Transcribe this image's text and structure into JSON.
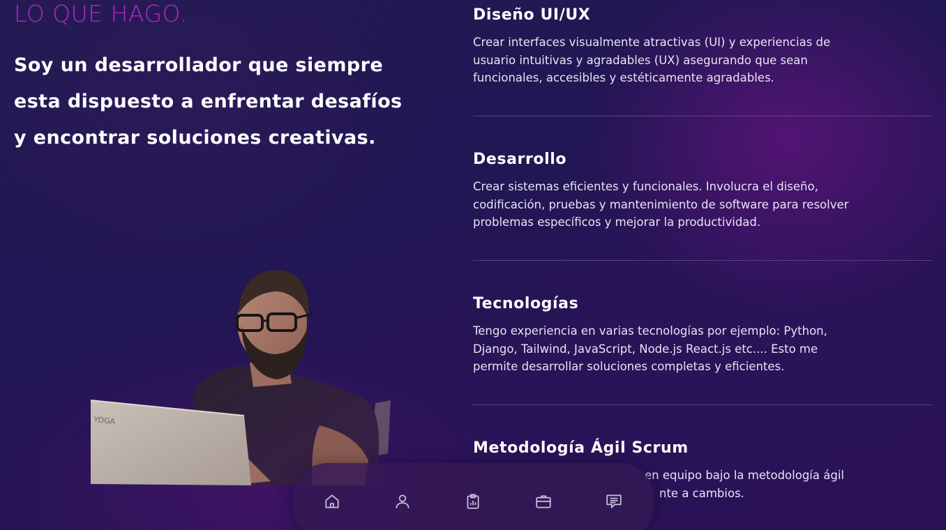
{
  "section_label": "LO QUE HAGO.",
  "intro": "Soy un desarrollador que siempre esta dispuesto a enfrentar desafíos y encontrar soluciones creativas.",
  "portrait": {
    "laptop_brand": "YOGA"
  },
  "services": [
    {
      "title": "Diseño UI/UX",
      "description": "Crear interfaces visualmente atractivas (UI) y experiencias de usuario intuitivas y agradables (UX) asegurando que sean funcionales, accesibles y estéticamente agradables."
    },
    {
      "title": "Desarrollo",
      "description": "Crear sistemas eficientes y funcionales. Involucra el diseño, codificación, pruebas y mantenimiento de software para resolver problemas específicos y mejorar la productividad."
    },
    {
      "title": "Tecnologías",
      "description": "Tengo experiencia en varias tecnologías por ejemplo: Python, Django, Tailwind, JavaScript, Node.js React.js etc.... Esto me permite desarrollar soluciones completas y eficientes."
    },
    {
      "title": "Metodología Ágil Scrum",
      "description_line1_visible": "en equipo bajo la metodología ágil",
      "description_line2_visible": "nte a cambios."
    }
  ],
  "nav": {
    "items": [
      {
        "icon": "home-icon"
      },
      {
        "icon": "user-icon"
      },
      {
        "icon": "clipboard-icon"
      },
      {
        "icon": "briefcase-icon"
      },
      {
        "icon": "message-icon"
      }
    ],
    "icon_color": "#c9c3dc"
  },
  "colors": {
    "accent": "#b327c8",
    "background": "#241a52",
    "text": "#ffffff"
  }
}
